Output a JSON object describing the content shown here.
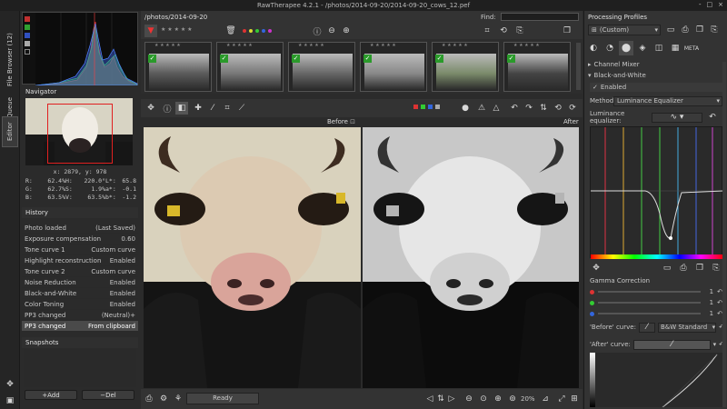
{
  "window": {
    "title": "RawTherapee 4.2.1 - /photos/2014-09-20/2014-09-20_cows_12.pef",
    "controls": [
      "-",
      "□",
      "×"
    ]
  },
  "side_tabs": [
    "Editor",
    "Queue",
    "File Browser (12)"
  ],
  "navigator": {
    "title": "Navigator",
    "coords": "x: 2879, y: 978",
    "readouts": [
      [
        "R:",
        "62.4%",
        "H:",
        "220.0°",
        "L*:",
        "65.8"
      ],
      [
        "G:",
        "62.7%",
        "S:",
        "1.9%",
        "a*:",
        "-0.1"
      ],
      [
        "B:",
        "63.5%",
        "V:",
        "63.5%",
        "b*:",
        "-1.2"
      ]
    ]
  },
  "history": {
    "title": "History",
    "rows": [
      {
        "name": "Photo loaded",
        "value": "(Last Saved)"
      },
      {
        "name": "Exposure compensation",
        "value": "0.60"
      },
      {
        "name": "Tone curve 1",
        "value": "Custom curve"
      },
      {
        "name": "Highlight reconstruction",
        "value": "Enabled"
      },
      {
        "name": "Tone curve 2",
        "value": "Custom curve"
      },
      {
        "name": "Noise Reduction",
        "value": "Enabled"
      },
      {
        "name": "Black-and-White",
        "value": "Enabled"
      },
      {
        "name": "Color Toning",
        "value": "Enabled"
      },
      {
        "name": "PP3 changed",
        "value": "(Neutral)+"
      },
      {
        "name": "PP3 changed",
        "value": "From clipboard"
      }
    ]
  },
  "snapshots": {
    "title": "Snapshots",
    "add_label": "+Add",
    "del_label": "−Del"
  },
  "filmstrip": {
    "path": "/photos/2014-09-20",
    "find_label": "Find:"
  },
  "editor": {
    "before_label": "Before",
    "after_label": "After",
    "status": "Ready",
    "zoom": "20%"
  },
  "right_panel": {
    "profiles_title": "Processing Profiles",
    "profile_value": "(Custom)",
    "channel_mixer_label": "Channel Mixer",
    "bw_label": "Black-and-White",
    "enabled_label": "Enabled",
    "method_label": "Method:",
    "method_value": "Luminance Equalizer",
    "lum_eq_label": "Luminance equalizer:",
    "gamma_title": "Gamma Correction",
    "gamma_values": [
      "1",
      "1",
      "1"
    ],
    "before_curve_label": "'Before' curve:",
    "before_curve_value": "B&W Standard",
    "after_curve_label": "'After' curve:"
  },
  "colors": {
    "accent": "#d9342b",
    "background": "#2b2b2b",
    "panel": "#333333"
  }
}
